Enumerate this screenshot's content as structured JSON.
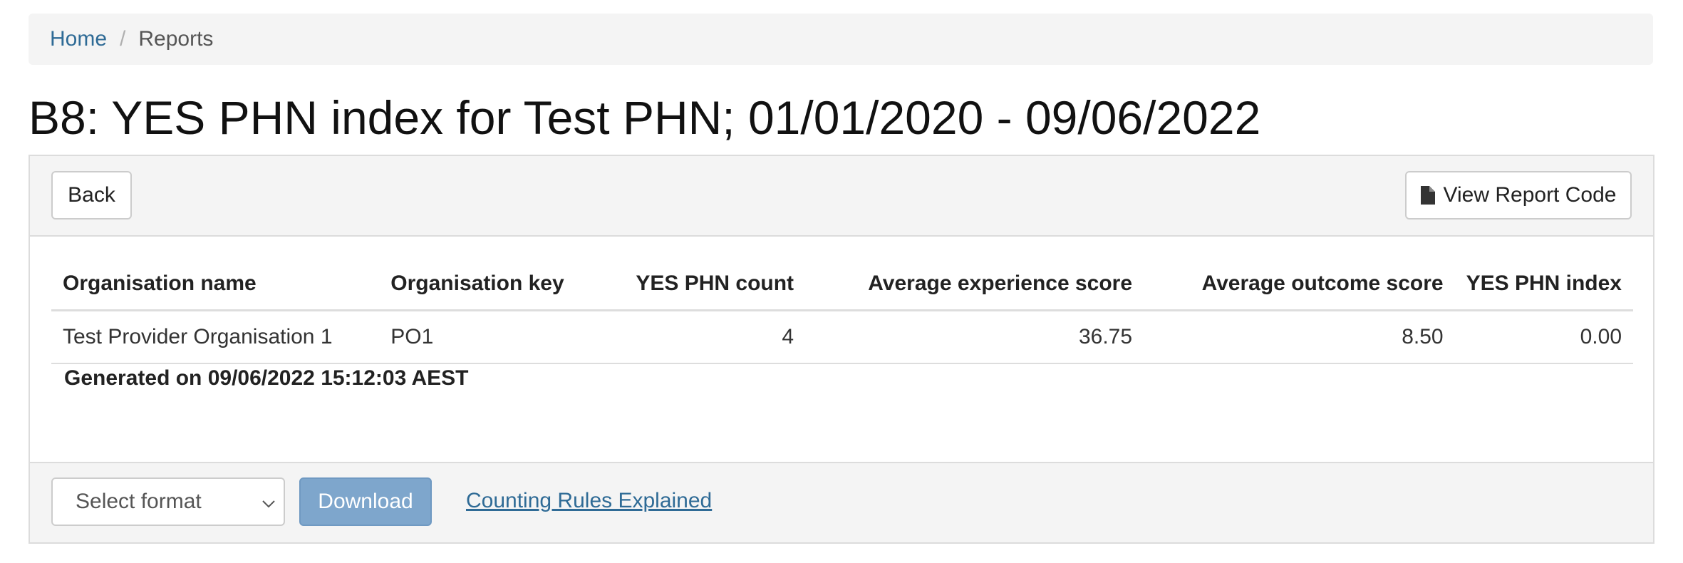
{
  "breadcrumb": {
    "home": "Home",
    "separator": "/",
    "current": "Reports"
  },
  "page": {
    "title": "B8: YES PHN index for Test PHN; 01/01/2020 - 09/06/2022"
  },
  "toolbar": {
    "back_label": "Back",
    "view_code_label": "View Report Code",
    "view_code_icon": "file-icon"
  },
  "table": {
    "headers": [
      "Organisation name",
      "Organisation key",
      "YES PHN count",
      "Average experience score",
      "Average outcome score",
      "YES PHN index"
    ],
    "rows": [
      [
        "Test Provider Organisation 1",
        "PO1",
        "4",
        "36.75",
        "8.50",
        "0.00"
      ]
    ]
  },
  "generated_text": "Generated on 09/06/2022 15:12:03 AEST",
  "footer": {
    "format_select": "Select format",
    "download_label": "Download",
    "rules_link": "Counting Rules Explained"
  },
  "colors": {
    "link": "#2f6b96",
    "download_button": "#7ea6cc",
    "panel_bg": "#f4f4f4"
  }
}
